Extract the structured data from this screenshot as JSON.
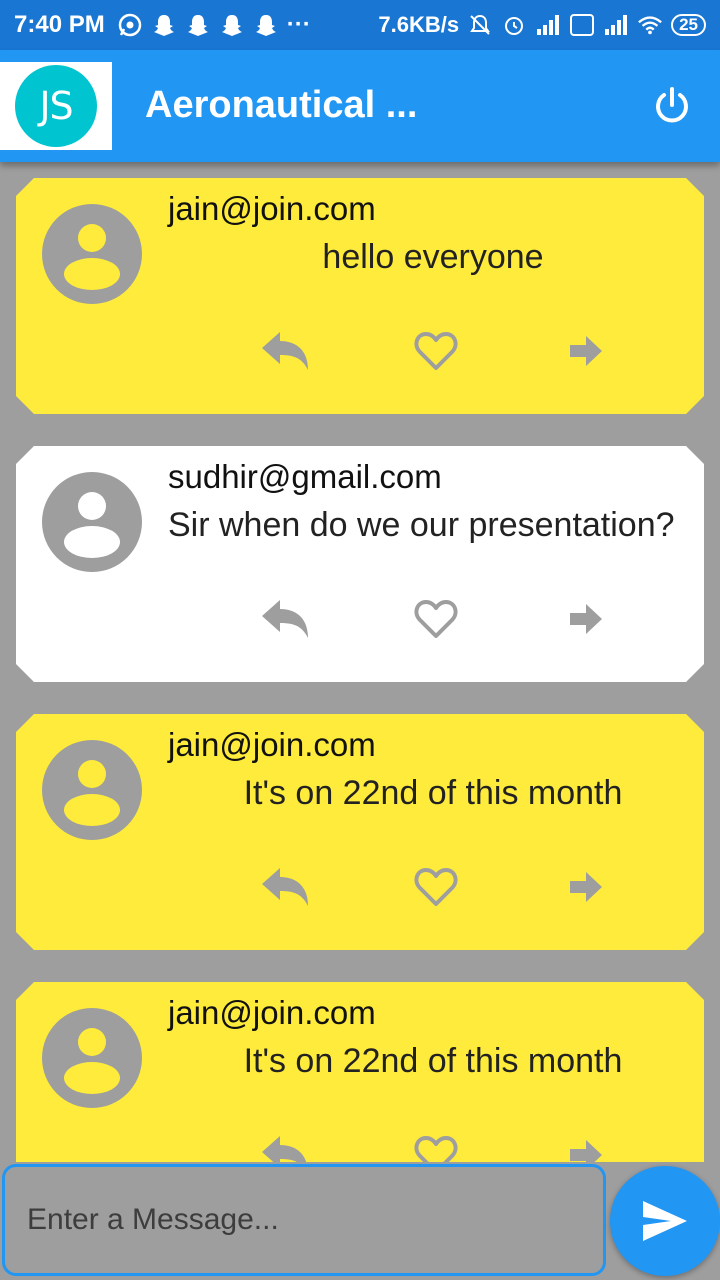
{
  "status_bar": {
    "time": "7:40 PM",
    "dots": "···",
    "speed": "7.6KB/s",
    "battery": "25"
  },
  "app_bar": {
    "logo_text": "JS",
    "title": "Aeronautical ...",
    "power_icon": "power-icon"
  },
  "messages": [
    {
      "sender": "jain@join.com",
      "text": "hello everyone",
      "color": "#ffeb3b"
    },
    {
      "sender": "sudhir@gmail.com",
      "text": "Sir when do we our presentation?",
      "color": "#ffffff"
    },
    {
      "sender": "jain@join.com",
      "text": "It's on 22nd of this month",
      "color": "#ffeb3b"
    },
    {
      "sender": "jain@join.com",
      "text": "It's on 22nd of this month",
      "color": "#ffeb3b"
    }
  ],
  "input": {
    "placeholder": "Enter a Message..."
  },
  "colors": {
    "primary": "#2196f3",
    "status_bar": "#1976d2",
    "own_message": "#ffeb3b",
    "other_message": "#ffffff",
    "background": "#9e9e9e",
    "icon_gray": "#9e9e9e"
  }
}
